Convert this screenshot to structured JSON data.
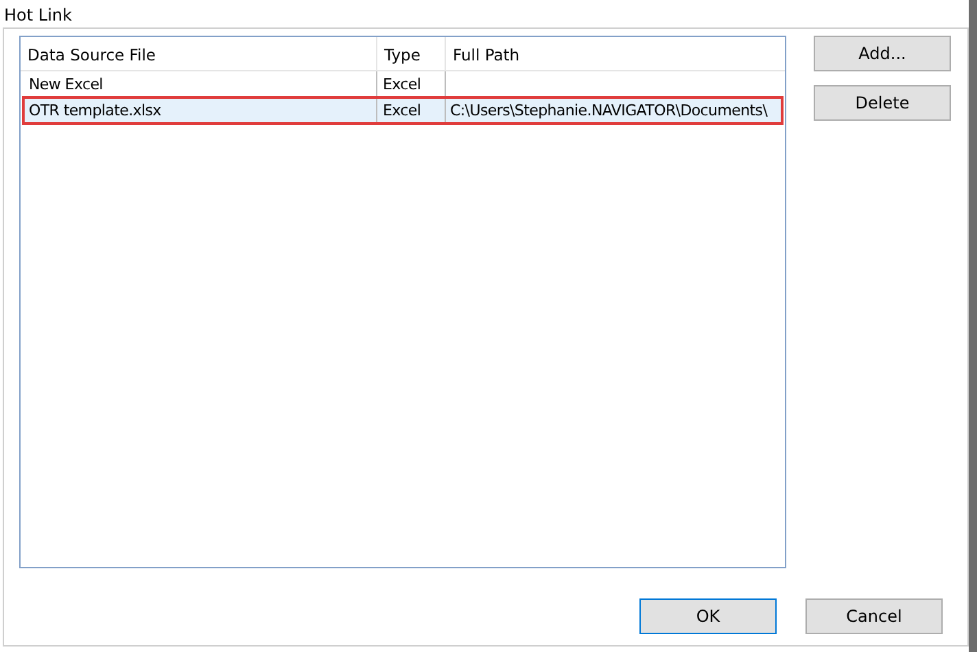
{
  "window": {
    "title": "Hot Link"
  },
  "table": {
    "columns": [
      "Data Source File",
      "Type",
      "Full Path"
    ],
    "rows": [
      {
        "cells": [
          "New Excel",
          "Excel",
          ""
        ],
        "selected": false
      },
      {
        "cells": [
          "OTR template.xlsx",
          "Excel",
          "C:\\Users\\Stephanie.NAVIGATOR\\Documents\\"
        ],
        "selected": true
      }
    ]
  },
  "side_buttons": [
    "Add...",
    "Delete"
  ],
  "buttons": [
    {
      "label": "OK",
      "default": true
    },
    {
      "label": "Cancel",
      "default": false
    }
  ]
}
